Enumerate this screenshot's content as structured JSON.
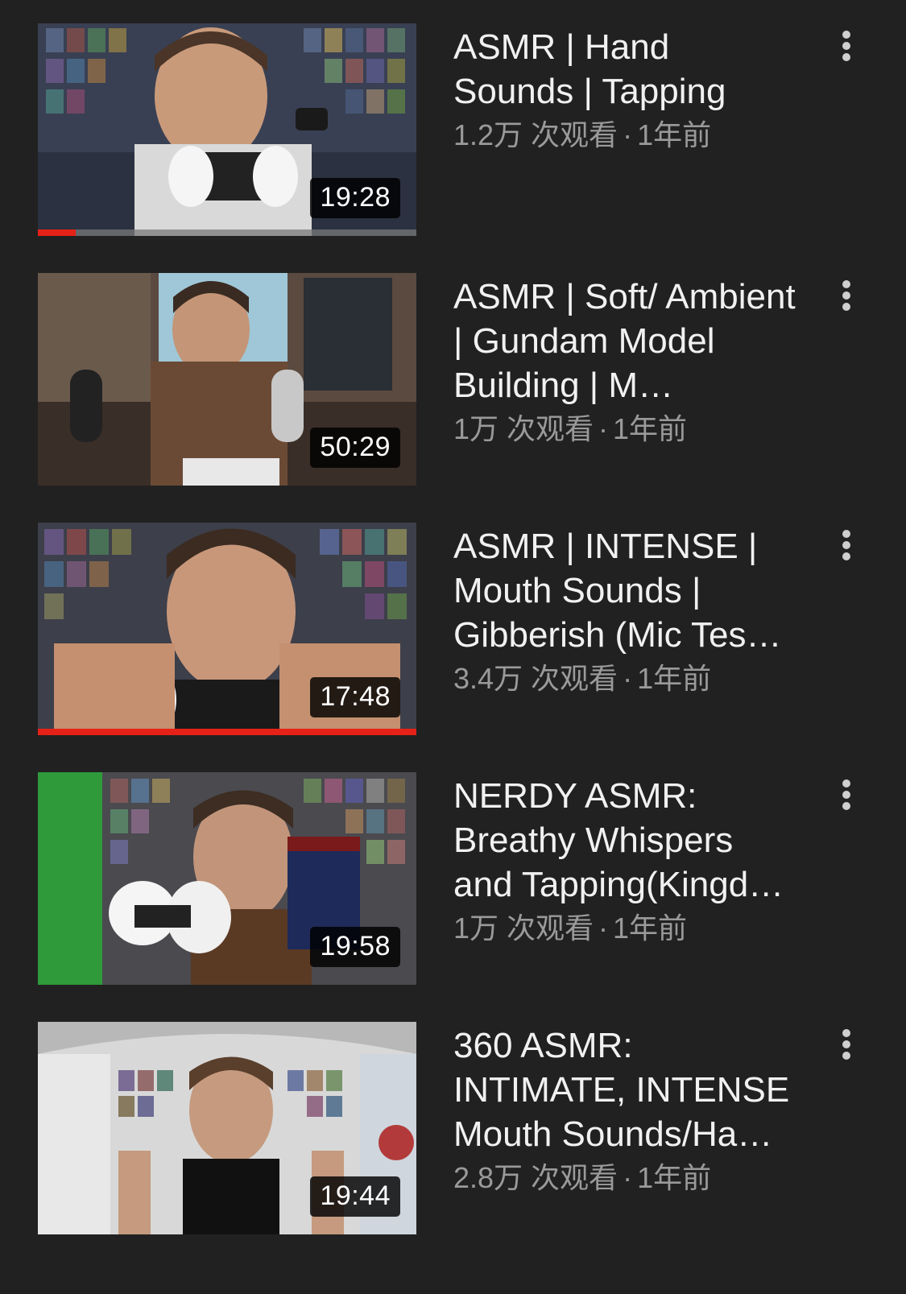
{
  "colors": {
    "background": "#212121",
    "title": "#f1f1f1",
    "meta": "#9a9a9a",
    "progress": "#e62117"
  },
  "videos": [
    {
      "title": "ASMR | Hand Sounds | Tapping",
      "duration": "19:28",
      "views": "1.2万 次观看",
      "separator": "·",
      "age": "1年前",
      "watch_progress": 0.1,
      "thumbnail": "man-with-3dio-mic-game-shelves"
    },
    {
      "title": "ASMR | Soft/ Ambient | Gundam Model Building | M…",
      "duration": "50:29",
      "views": "1万 次观看",
      "separator": "·",
      "age": "1年前",
      "watch_progress": 0,
      "thumbnail": "man-with-headphones-blue-yeti-mic"
    },
    {
      "title": "ASMR | INTENSE | Mouth Sounds | Gibberish (Mic Tes…",
      "duration": "17:48",
      "views": "3.4万 次观看",
      "separator": "·",
      "age": "1年前",
      "watch_progress": 1.0,
      "thumbnail": "man-close-to-camera-game-wall"
    },
    {
      "title": "NERDY ASMR: Breathy Whispers and Tapping(Kingd…",
      "duration": "19:58",
      "views": "1万 次观看",
      "separator": "·",
      "age": "1年前",
      "watch_progress": 0,
      "thumbnail": "man-holding-kingdom-hearts-case"
    },
    {
      "title": "360 ASMR: INTIMATE, INTENSE Mouth Sounds/Ha…",
      "duration": "19:44",
      "views": "2.8万 次观看",
      "separator": "·",
      "age": "1年前",
      "watch_progress": 0,
      "thumbnail": "man-360-fisheye-room"
    }
  ]
}
